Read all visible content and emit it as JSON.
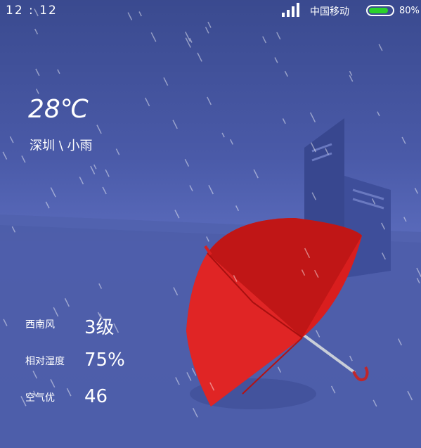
{
  "status_bar": {
    "time": "12 : 12",
    "carrier": "中国移动",
    "battery_percent": "80%",
    "battery_level": 0.8,
    "signal_bars": 4
  },
  "weather": {
    "temperature": "28℃",
    "location_condition": "深圳 \\ 小雨"
  },
  "stats": [
    {
      "label": "西南风",
      "value": "3级"
    },
    {
      "label": "相对湿度",
      "value": "75%"
    },
    {
      "label": "空气优",
      "value": "46"
    }
  ],
  "colors": {
    "umbrella": "#d91e1e",
    "battery": "#2bd32b",
    "sky": "#4a5aa8"
  },
  "icons": [
    "signal-icon",
    "battery-icon",
    "umbrella-illustration",
    "building-illustration"
  ]
}
